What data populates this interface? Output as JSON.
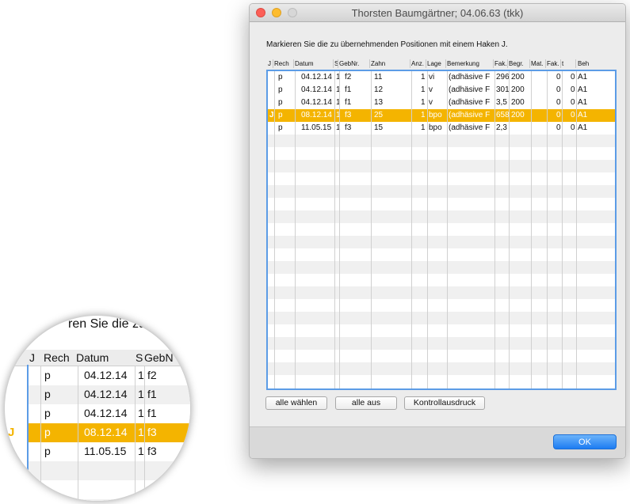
{
  "window": {
    "title": "Thorsten Baumgärtner; 04.06.63 (tkk)",
    "instruction": "Markieren Sie die zu übernehmenden Positionen mit einem Haken J."
  },
  "table": {
    "headers": [
      "J",
      "Rech",
      "Datum",
      "S",
      "GebNr.",
      "Zahn",
      "Anz.",
      "Lage",
      "Bemerkung",
      "Fak.",
      "Begr.",
      "Mat.",
      "Fak.",
      "t",
      "Beh"
    ],
    "rows": [
      {
        "j": "",
        "rech": "p",
        "datum": "04.12.14",
        "s": "1",
        "gebnr": "f2",
        "zahn": "11",
        "anz": "1",
        "lage": "vi",
        "bemerkung": "(adhäsive F",
        "fak": "296",
        "begr": "200",
        "mat": "",
        "fak2": "0",
        "t": "0",
        "beh": "A1",
        "selected": false
      },
      {
        "j": "",
        "rech": "p",
        "datum": "04.12.14",
        "s": "1",
        "gebnr": "f1",
        "zahn": "12",
        "anz": "1",
        "lage": "v",
        "bemerkung": "(adhäsive F",
        "fak": "301",
        "begr": "200",
        "mat": "",
        "fak2": "0",
        "t": "0",
        "beh": "A1",
        "selected": false
      },
      {
        "j": "",
        "rech": "p",
        "datum": "04.12.14",
        "s": "1",
        "gebnr": "f1",
        "zahn": "13",
        "anz": "1",
        "lage": "v",
        "bemerkung": "(adhäsive F",
        "fak": "3,5",
        "begr": "200",
        "mat": "",
        "fak2": "0",
        "t": "0",
        "beh": "A1",
        "selected": false
      },
      {
        "j": "J",
        "rech": "p",
        "datum": "08.12.14",
        "s": "1",
        "gebnr": "f3",
        "zahn": "25",
        "anz": "1",
        "lage": "bpo",
        "bemerkung": "(adhäsive F",
        "fak": "658",
        "begr": "200",
        "mat": "",
        "fak2": "0",
        "t": "0",
        "beh": "A1",
        "selected": true
      },
      {
        "j": "",
        "rech": "p",
        "datum": "11.05.15",
        "s": "1",
        "gebnr": "f3",
        "zahn": "15",
        "anz": "1",
        "lage": "bpo",
        "bemerkung": "(adhäsive F",
        "fak": "2,3",
        "begr": "",
        "mat": "",
        "fak2": "0",
        "t": "0",
        "beh": "A1",
        "selected": false
      }
    ]
  },
  "buttons": {
    "select_all": "alle wählen",
    "deselect_all": "alle aus",
    "control_print": "Kontrollausdruck",
    "ok": "OK"
  },
  "magnifier": {
    "instruction_fragment": "ren Sie die zu",
    "headers": [
      "J",
      "Rech",
      "Datum",
      "S",
      "GebN"
    ],
    "rows": [
      {
        "j": "",
        "rech": "p",
        "datum": "04.12.14",
        "s": "1",
        "gebnr": "f2"
      },
      {
        "j": "",
        "rech": "p",
        "datum": "04.12.14",
        "s": "1",
        "gebnr": "f1"
      },
      {
        "j": "",
        "rech": "p",
        "datum": "04.12.14",
        "s": "1",
        "gebnr": "f1"
      },
      {
        "j": "J",
        "rech": "p",
        "datum": "08.12.14",
        "s": "1",
        "gebnr": "f3"
      },
      {
        "j": "",
        "rech": "p",
        "datum": "11.05.15",
        "s": "1",
        "gebnr": "f3"
      }
    ]
  },
  "colors": {
    "selection": "#f4b400",
    "table_border": "#5c9ce6",
    "ok_button": "#1d7cf2"
  }
}
